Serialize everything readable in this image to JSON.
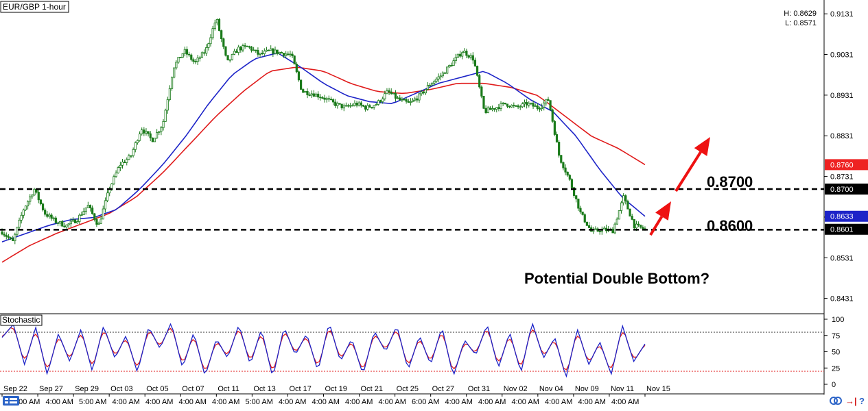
{
  "window": {
    "symbol_label": "EUR/GBP 1-hour",
    "high_label": "H: 0.8629",
    "low_label": "L: 0.8571"
  },
  "colors": {
    "candle": "#1a7a1a",
    "ma_fast": "#1d24c8",
    "ma_slow": "#e01b1b",
    "stoch_k": "#1d24c8",
    "stoch_d": "#e01b1b",
    "annotation_arrow": "#ee1111",
    "price_tag_red": "#ee2222",
    "price_tag_black": "#000000",
    "price_tag_blue": "#1d24c8"
  },
  "chart_data": [
    {
      "type": "line",
      "panel": "price",
      "title": "EUR/GBP 1-hour",
      "xlabel": "",
      "ylabel": "",
      "ylim": [
        0.8395,
        0.9165
      ],
      "y_ticks": [
        "0.9131",
        "0.9031",
        "0.8931",
        "0.8831",
        "0.8731",
        "0.8631",
        "0.8531",
        "0.8431"
      ],
      "x_labels": [
        "Sep 22",
        "Sep 27",
        "Sep 29",
        "Oct 03",
        "Oct 05",
        "Oct 07",
        "Oct 11",
        "Oct 13",
        "Oct 17",
        "Oct 19",
        "Oct 21",
        "Oct 25",
        "Oct 27",
        "Oct 31",
        "Nov 02",
        "Nov 04",
        "Nov 09",
        "Nov 11",
        "Nov 15"
      ],
      "x_time_labels": [
        "4:00 AM",
        "4:00 AM",
        "5:00 AM",
        "4:00 AM",
        "4:00 AM",
        "4:00 AM",
        "4:00 AM",
        "5:00 AM",
        "4:00 AM",
        "4:00 AM",
        "4:00 AM",
        "4:00 AM",
        "6:00 AM",
        "4:00 AM",
        "4:00 AM",
        "4:00 AM",
        "4:00 AM",
        "4:00 AM",
        "4:00 AM"
      ],
      "price_path": [
        0.8595,
        0.857,
        0.865,
        0.87,
        0.864,
        0.862,
        0.861,
        0.8625,
        0.866,
        0.861,
        0.87,
        0.876,
        0.878,
        0.885,
        0.882,
        0.886,
        0.9,
        0.904,
        0.901,
        0.904,
        0.912,
        0.901,
        0.9045,
        0.905,
        0.903,
        0.904,
        0.9035,
        0.903,
        0.894,
        0.8935,
        0.8925,
        0.891,
        0.89,
        0.891,
        0.89,
        0.891,
        0.894,
        0.892,
        0.891,
        0.893,
        0.896,
        0.898,
        0.901,
        0.904,
        0.902,
        0.889,
        0.89,
        0.891,
        0.89,
        0.891,
        0.89,
        0.892,
        0.878,
        0.872,
        0.864,
        0.8595,
        0.86,
        0.8598,
        0.868,
        0.861,
        0.8601
      ],
      "ma_fast": [
        0.857,
        0.859,
        0.861,
        0.8625,
        0.863,
        0.865,
        0.87,
        0.876,
        0.883,
        0.891,
        0.898,
        0.902,
        0.9035,
        0.9,
        0.896,
        0.893,
        0.8915,
        0.891,
        0.8935,
        0.896,
        0.8975,
        0.899,
        0.896,
        0.892,
        0.889,
        0.883,
        0.875,
        0.868,
        0.8633
      ],
      "ma_slow": [
        0.852,
        0.856,
        0.859,
        0.8615,
        0.864,
        0.868,
        0.874,
        0.881,
        0.888,
        0.894,
        0.899,
        0.9,
        0.899,
        0.896,
        0.894,
        0.8935,
        0.8945,
        0.896,
        0.896,
        0.895,
        0.893,
        0.888,
        0.883,
        0.88,
        0.876
      ],
      "levels": [
        {
          "value": 0.87,
          "label": "0.8700"
        },
        {
          "value": 0.86,
          "label": "0.8600"
        }
      ],
      "price_tags": [
        {
          "value": 0.876,
          "label": "0.8760",
          "color": "#ee2222"
        },
        {
          "value": 0.87,
          "label": "0.8700",
          "color": "#000000"
        },
        {
          "value": 0.8633,
          "label": "0.8633",
          "color": "#1d24c8"
        },
        {
          "value": 0.8601,
          "label": "0.8601",
          "color": "#000000"
        }
      ],
      "annotation": "Potential Double Bottom?",
      "grid": false
    },
    {
      "type": "line",
      "panel": "stochastic",
      "title": "Stochastic",
      "ylim": [
        0,
        100
      ],
      "y_ticks": [
        "100",
        "75",
        "50",
        "25",
        "0"
      ],
      "reference_levels": [
        80,
        20
      ],
      "k_values": [
        72,
        92,
        30,
        88,
        15,
        78,
        35,
        85,
        20,
        90,
        40,
        75,
        18,
        88,
        55,
        95,
        25,
        80,
        12,
        70,
        40,
        92,
        30,
        85,
        10,
        88,
        45,
        78,
        20,
        95,
        35,
        70,
        15,
        82,
        50,
        90,
        22,
        75,
        30,
        88,
        12,
        68,
        45,
        92,
        25,
        80,
        18,
        95,
        40,
        72,
        10,
        85,
        30,
        65,
        15,
        90,
        35,
        62
      ]
    }
  ]
}
